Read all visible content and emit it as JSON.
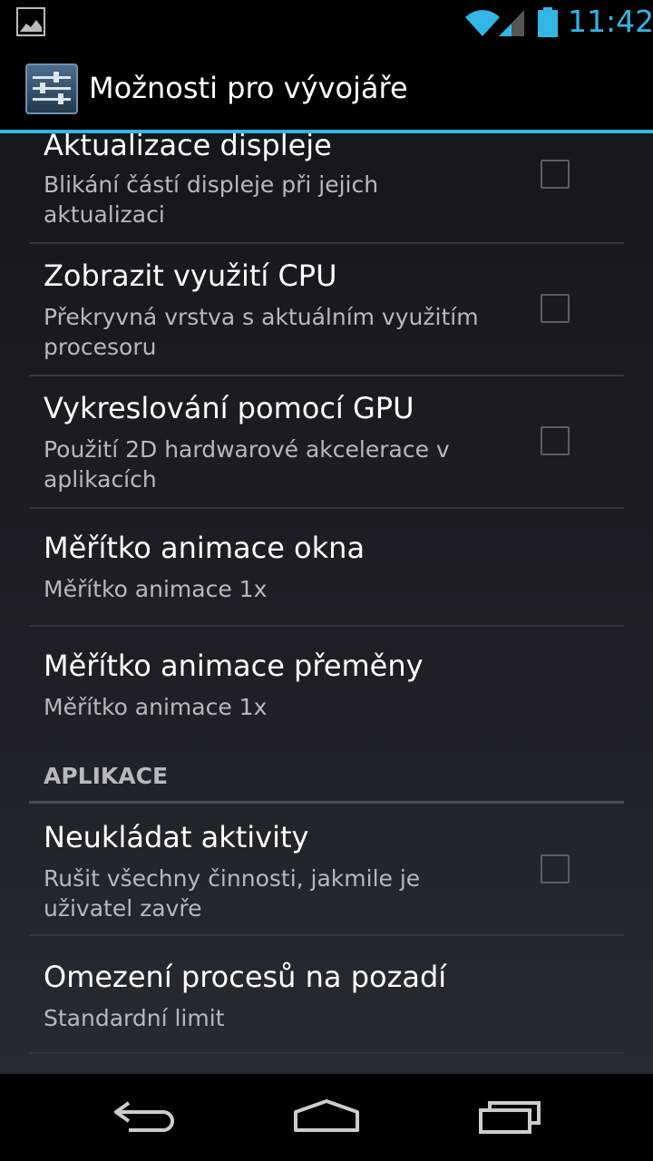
{
  "status_bar": {
    "time": "11:42",
    "icons": [
      "gallery-icon",
      "wifi-icon",
      "signal-icon",
      "battery-icon"
    ]
  },
  "action_bar": {
    "title": "Možnosti pro vývojáře",
    "icon": "settings-sliders-icon"
  },
  "preferences": [
    {
      "title": "Aktualizace displeje",
      "summary": "Blikání částí displeje při jejich aktualizaci",
      "checkbox": true,
      "checked": false
    },
    {
      "title": "Zobrazit využití CPU",
      "summary": "Překryvná vrstva s aktuálním využitím procesoru",
      "checkbox": true,
      "checked": false
    },
    {
      "title": "Vykreslování pomocí GPU",
      "summary": "Použití 2D hardwarové akcelerace v aplikacích",
      "checkbox": true,
      "checked": false
    },
    {
      "title": "Měřítko animace okna",
      "summary": "Měřítko animace 1x",
      "checkbox": false
    },
    {
      "title": "Měřítko animace přeměny",
      "summary": "Měřítko animace 1x",
      "checkbox": false
    }
  ],
  "category": {
    "label": "APLIKACE"
  },
  "app_preferences": [
    {
      "title": "Neukládat aktivity",
      "summary": "Rušit všechny činnosti, jakmile je uživatel zavře",
      "checkbox": true,
      "checked": false
    },
    {
      "title": "Omezení procesů na pozadí",
      "summary": "Standardní limit",
      "checkbox": false
    }
  ],
  "nav_bar": {
    "buttons": [
      "back-icon",
      "home-icon",
      "recents-icon"
    ]
  },
  "colors": {
    "accent": "#33b5e5",
    "summary_text": "#b6b9bd",
    "divider": "#33363b"
  }
}
